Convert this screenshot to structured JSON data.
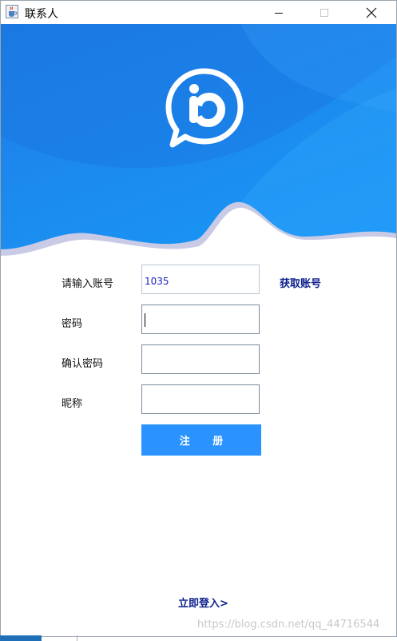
{
  "window": {
    "title": "联系人",
    "app_icon": "java-coffee-icon",
    "controls": [
      "minimize-icon",
      "maximize-icon",
      "close-icon"
    ]
  },
  "banner": {
    "logo_icon": "chat-bubble-b-icon",
    "colors": {
      "top": "#1e7fe8",
      "bottom": "#1894f4",
      "wave_shadow": "#c9cbe6"
    }
  },
  "form": {
    "account_label": "请输入账号",
    "account_value": "1035",
    "get_account_link": "获取账号",
    "password_label": "密码",
    "password_value": "",
    "confirm_label": "确认密码",
    "confirm_value": "",
    "nickname_label": "昵称",
    "nickname_value": "",
    "register_button": "注 册",
    "login_link": "立即登入>"
  },
  "colors": {
    "accent": "#2a93ff",
    "link": "#0b1f8a",
    "value_text": "#2020c0"
  },
  "watermark": "https://blog.csdn.net/qq_44716544"
}
